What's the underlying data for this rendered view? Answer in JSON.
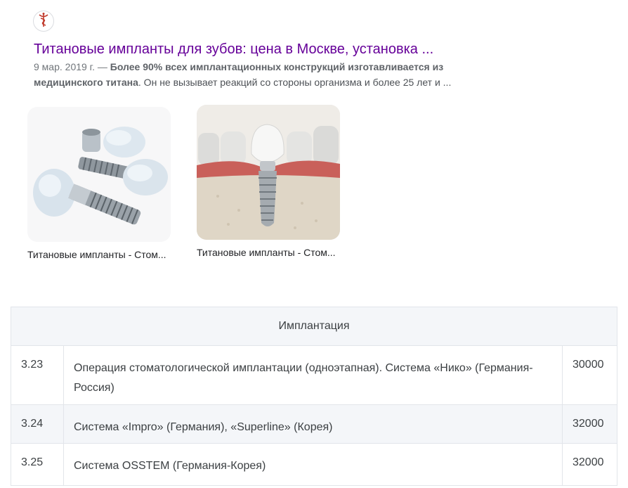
{
  "result": {
    "favicon": "caduceus-icon",
    "title": "Титановые импланты для зубов: цена в Москве, установка ...",
    "date": "9 мар. 2019 г. — ",
    "snippet_bold": "Более 90% всех имплантационных конструкций изготавливается из медицинского титана",
    "snippet_rest": ". Он не вызывает реакций со стороны организма и более 25 лет и ..."
  },
  "images": [
    {
      "caption": "Титановые импланты - Стом..."
    },
    {
      "caption": "Титановые импланты - Стом..."
    }
  ],
  "table": {
    "header": "Имплантация",
    "rows": [
      {
        "code": "3.23",
        "description": "Операция стоматологической имплантации (одноэтапная). Система «Нико» (Германия-Россия)",
        "price": "30000"
      },
      {
        "code": "3.24",
        "description": "Система «Impro» (Германия), «Superline» (Корея)",
        "price": "32000"
      },
      {
        "code": "3.25",
        "description": "Система OSSTEM (Германия-Корея)",
        "price": "32000"
      }
    ]
  }
}
